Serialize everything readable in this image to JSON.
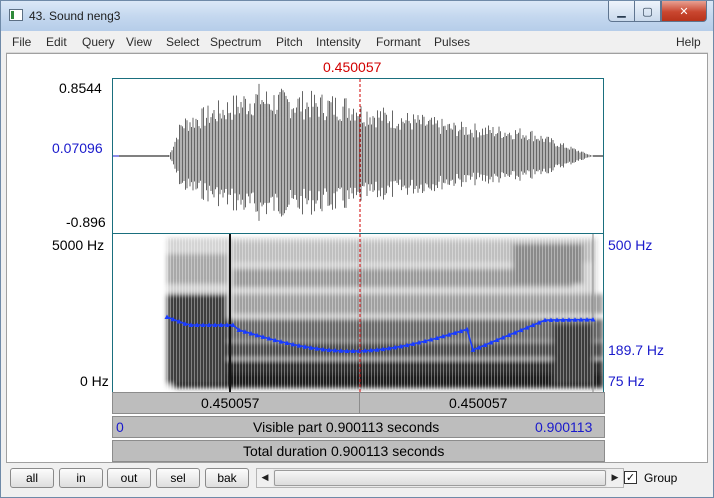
{
  "window": {
    "title": "43. Sound neng3",
    "min": "▁",
    "max": "▢",
    "close": "✕"
  },
  "menu": [
    "File",
    "Edit",
    "Query",
    "View",
    "Select",
    "Spectrum",
    "Pitch",
    "Intensity",
    "Formant",
    "Pulses",
    "Help"
  ],
  "cursor_time": "0.450057",
  "waveform": {
    "top": "0.8544",
    "mid": "0.07096",
    "bottom": "-0.896"
  },
  "spectrogram": {
    "left_top": "5000 Hz",
    "left_bottom": "0 Hz",
    "right_top": "500 Hz",
    "right_mid": "189.7 Hz",
    "right_bottom": "75 Hz"
  },
  "time_bar": {
    "left": "0.450057",
    "right": "0.450057"
  },
  "visible_bar": {
    "start": "0",
    "label": "Visible part 0.900113 seconds",
    "end": "0.900113"
  },
  "total_bar": {
    "label": "Total duration 0.900113 seconds"
  },
  "buttons": {
    "all": "all",
    "in": "in",
    "out": "out",
    "sel": "sel",
    "bak": "bak"
  },
  "group": {
    "label": "Group",
    "checked": "✓"
  },
  "colors": {
    "cursor": "#d20000",
    "pitch": "#1a3cff",
    "axis_blue": "#1a1acc"
  }
}
